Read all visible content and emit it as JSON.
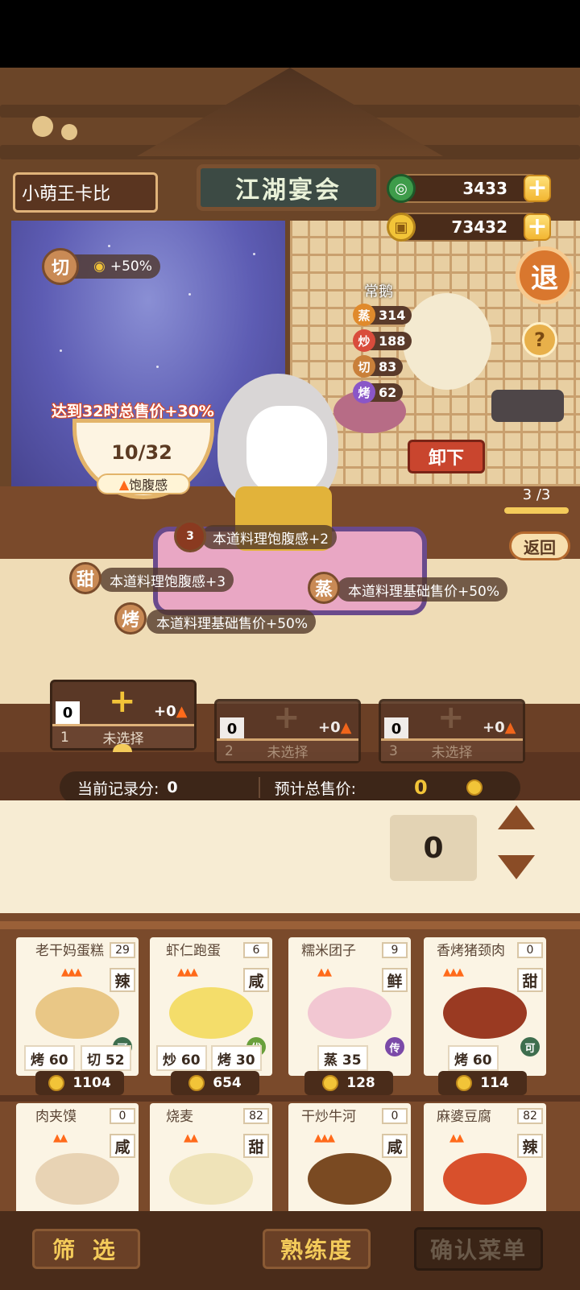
{
  "header": {
    "player_name": "小萌王卡比",
    "title": "江湖宴会",
    "jade": "3433",
    "coins": "73432",
    "exit_label": "退",
    "help_label": "?"
  },
  "bonus": {
    "cut_tag": "切",
    "cut_bonus": "+50%"
  },
  "chef": {
    "name": "常鹅",
    "stats": [
      {
        "k": "蒸",
        "v": "314",
        "color": "#e08a2c"
      },
      {
        "k": "炒",
        "v": "188",
        "color": "#d94c3c"
      },
      {
        "k": "切",
        "v": "83",
        "color": "#c9803a"
      },
      {
        "k": "烤",
        "v": "62",
        "color": "#8a56c8"
      }
    ],
    "unload_label": "卸下"
  },
  "satiety": {
    "goal_text": "达到32时总售价+30%",
    "value": "10/32",
    "label": "饱腹感"
  },
  "page": {
    "counter": "3 /3",
    "back_label": "返回"
  },
  "buffs": [
    {
      "tag": "3",
      "text": "本道料理饱腹感+2"
    },
    {
      "tag": "甜",
      "text": "本道料理饱腹感+3"
    },
    {
      "tag": "蒸",
      "text": "本道料理基础售价+50%"
    },
    {
      "tag": "烤",
      "text": "本道料理基础售价+50%"
    }
  ],
  "slots": [
    {
      "num": "1",
      "score": "0",
      "fire": "+0",
      "label": "未选择"
    },
    {
      "num": "2",
      "score": "0",
      "fire": "+0",
      "label": "未选择"
    },
    {
      "num": "3",
      "score": "0",
      "fire": "+0",
      "label": "未选择"
    }
  ],
  "summary": {
    "record_label": "当前记录分:",
    "record_value": "0",
    "price_label": "预计总售价:",
    "price_value": "0"
  },
  "quantity": "0",
  "dishes": [
    {
      "name": "老干妈蛋糕",
      "count": "29",
      "flavor": "辣",
      "flames": 3,
      "grade": "可",
      "grade_color": "#3e6e4e",
      "skills": [
        "烤 60",
        "切 52"
      ],
      "price": "1104",
      "dish_color": "#e9c786"
    },
    {
      "name": "虾仁跑蛋",
      "count": "6",
      "flavor": "咸",
      "flames": 3,
      "grade": "优",
      "grade_color": "#6aa03c",
      "skills": [
        "炒 60",
        "烤 30"
      ],
      "price": "654",
      "dish_color": "#f4dd6a"
    },
    {
      "name": "糯米团子",
      "count": "9",
      "flavor": "鲜",
      "flames": 2,
      "grade": "传",
      "grade_color": "#7b4aa8",
      "skills": [
        "蒸 35"
      ],
      "price": "128",
      "dish_color": "#f2c7d2"
    },
    {
      "name": "香烤猪颈肉",
      "count": "0",
      "flavor": "甜",
      "flames": 3,
      "grade": "可",
      "grade_color": "#3e6e4e",
      "skills": [
        "烤 60"
      ],
      "price": "114",
      "dish_color": "#9a3a22"
    },
    {
      "name": "肉夹馍",
      "count": "0",
      "flavor": "咸",
      "flames": 2,
      "dish_color": "#e8d3b4"
    },
    {
      "name": "烧麦",
      "count": "82",
      "flavor": "甜",
      "flames": 2,
      "dish_color": "#efe3b8"
    },
    {
      "name": "干炒牛河",
      "count": "0",
      "flavor": "咸",
      "flames": 3,
      "dish_color": "#7a4a22"
    },
    {
      "name": "麻婆豆腐",
      "count": "82",
      "flavor": "辣",
      "flames": 2,
      "dish_color": "#d8502c"
    }
  ],
  "buttons": {
    "filter": "筛 选",
    "proficiency": "熟练度",
    "confirm": "确认菜单"
  }
}
